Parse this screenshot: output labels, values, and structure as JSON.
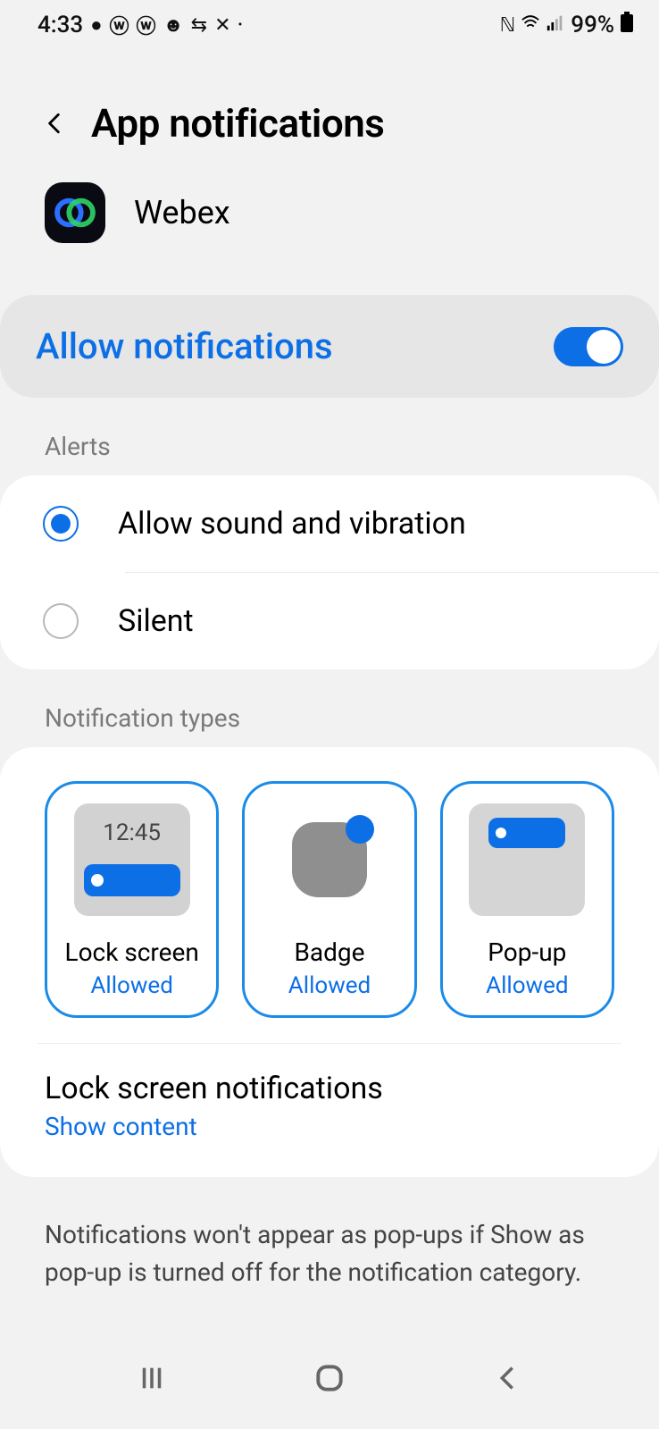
{
  "status": {
    "time": "4:33",
    "battery": "99%"
  },
  "header": {
    "title": "App notifications"
  },
  "app": {
    "name": "Webex"
  },
  "allow": {
    "label": "Allow notifications",
    "enabled": true
  },
  "sections": {
    "alerts": "Alerts",
    "types": "Notification types"
  },
  "alerts": {
    "options": [
      {
        "label": "Allow sound and vibration",
        "selected": true
      },
      {
        "label": "Silent",
        "selected": false
      }
    ]
  },
  "types": [
    {
      "title": "Lock screen",
      "status": "Allowed",
      "preview_time": "12:45"
    },
    {
      "title": "Badge",
      "status": "Allowed"
    },
    {
      "title": "Pop-up",
      "status": "Allowed"
    }
  ],
  "lock_screen_setting": {
    "title": "Lock screen notifications",
    "value": "Show content"
  },
  "footer": "Notifications won't appear as pop-ups if Show as pop-up is turned off for the notification category."
}
